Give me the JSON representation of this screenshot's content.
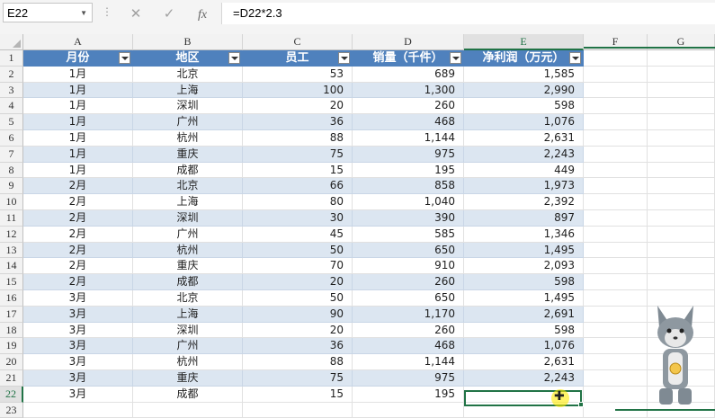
{
  "formula_bar": {
    "name_box": "E22",
    "fx_label": "fx",
    "formula": "=D22*2.3"
  },
  "columns": [
    "A",
    "B",
    "C",
    "D",
    "E",
    "F",
    "G"
  ],
  "headers": [
    "月份",
    "地区",
    "员工",
    "销量（千件）",
    "净利润（万元）"
  ],
  "rows": [
    [
      "1月",
      "北京",
      "53",
      "689",
      "1,585"
    ],
    [
      "1月",
      "上海",
      "100",
      "1,300",
      "2,990"
    ],
    [
      "1月",
      "深圳",
      "20",
      "260",
      "598"
    ],
    [
      "1月",
      "广州",
      "36",
      "468",
      "1,076"
    ],
    [
      "1月",
      "杭州",
      "88",
      "1,144",
      "2,631"
    ],
    [
      "1月",
      "重庆",
      "75",
      "975",
      "2,243"
    ],
    [
      "1月",
      "成都",
      "15",
      "195",
      "449"
    ],
    [
      "2月",
      "北京",
      "66",
      "858",
      "1,973"
    ],
    [
      "2月",
      "上海",
      "80",
      "1,040",
      "2,392"
    ],
    [
      "2月",
      "深圳",
      "30",
      "390",
      "897"
    ],
    [
      "2月",
      "广州",
      "45",
      "585",
      "1,346"
    ],
    [
      "2月",
      "杭州",
      "50",
      "650",
      "1,495"
    ],
    [
      "2月",
      "重庆",
      "70",
      "910",
      "2,093"
    ],
    [
      "2月",
      "成都",
      "20",
      "260",
      "598"
    ],
    [
      "3月",
      "北京",
      "50",
      "650",
      "1,495"
    ],
    [
      "3月",
      "上海",
      "90",
      "1,170",
      "2,691"
    ],
    [
      "3月",
      "深圳",
      "20",
      "260",
      "598"
    ],
    [
      "3月",
      "广州",
      "36",
      "468",
      "1,076"
    ],
    [
      "3月",
      "杭州",
      "88",
      "1,144",
      "2,631"
    ],
    [
      "3月",
      "重庆",
      "75",
      "975",
      "2,243"
    ],
    [
      "3月",
      "成都",
      "15",
      "195",
      ""
    ]
  ],
  "row_numbers": [
    "1",
    "2",
    "3",
    "4",
    "5",
    "6",
    "7",
    "8",
    "9",
    "10",
    "11",
    "12",
    "13",
    "14",
    "15",
    "16",
    "17",
    "18",
    "19",
    "20",
    "21",
    "22",
    "23"
  ],
  "selected_cell": "E22",
  "colors": {
    "header_blue": "#4f81bd",
    "band_blue": "#dce6f1",
    "excel_green": "#217346"
  }
}
